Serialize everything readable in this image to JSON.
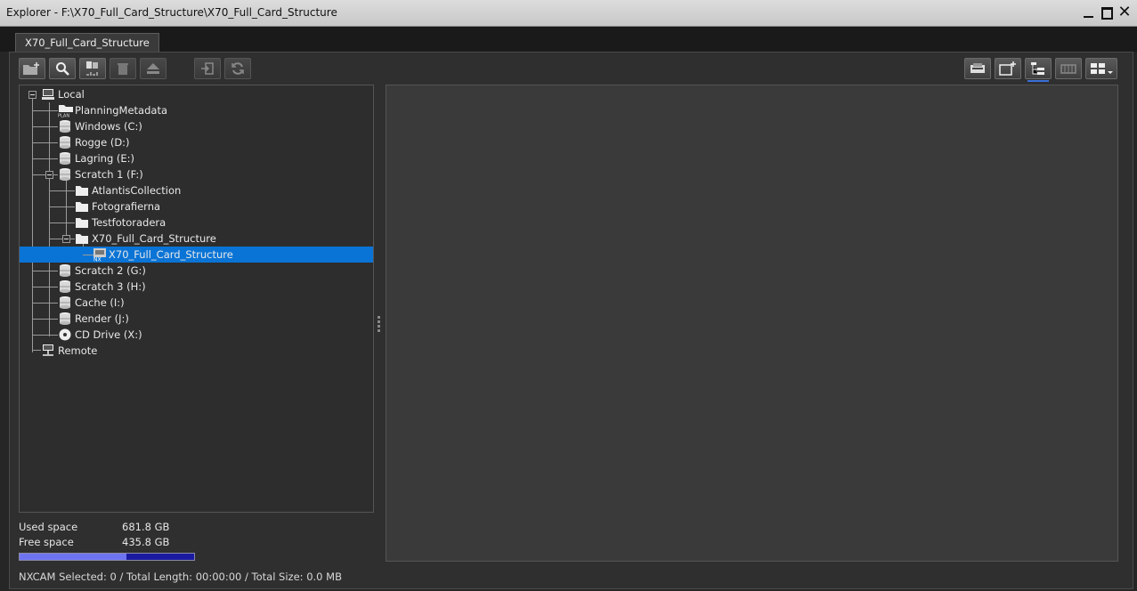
{
  "window": {
    "title": "Explorer - F:\\X70_Full_Card_Structure\\X70_Full_Card_Structure"
  },
  "tab": {
    "label": "X70_Full_Card_Structure"
  },
  "toolbar_left": [
    {
      "name": "new-folder-button",
      "icon": "new-folder-icon",
      "enabled": true
    },
    {
      "name": "search-button",
      "icon": "search-icon",
      "enabled": true
    },
    {
      "name": "select-all-button",
      "icon": "select-all-icon",
      "enabled": true
    },
    {
      "name": "delete-button",
      "icon": "trash-icon",
      "enabled": false
    },
    {
      "name": "eject-button",
      "icon": "eject-icon",
      "enabled": false
    },
    {
      "name": "import-button",
      "icon": "import-icon",
      "enabled": false
    },
    {
      "name": "refresh-button",
      "icon": "refresh-icon",
      "enabled": false
    }
  ],
  "toolbar_right": [
    {
      "name": "card-view-button",
      "icon": "card-reader-icon",
      "active": false
    },
    {
      "name": "new-window-button",
      "icon": "new-window-icon",
      "active": false
    },
    {
      "name": "tree-view-button",
      "icon": "tree-view-icon",
      "active": true
    },
    {
      "name": "list-view-button",
      "icon": "list-view-icon",
      "active": false
    },
    {
      "name": "thumbnail-view-button",
      "icon": "thumbnail-view-icon",
      "active": false
    }
  ],
  "tree": [
    {
      "label": "Local",
      "icon": "computer-icon",
      "level": 0,
      "expanded": true
    },
    {
      "label": "PlanningMetadata",
      "icon": "plan-folder-icon",
      "level": 1
    },
    {
      "label": "Windows (C:)",
      "icon": "drive-icon",
      "level": 1
    },
    {
      "label": "Rogge (D:)",
      "icon": "drive-icon",
      "level": 1
    },
    {
      "label": "Lagring (E:)",
      "icon": "drive-icon",
      "level": 1
    },
    {
      "label": "Scratch 1 (F:)",
      "icon": "drive-icon",
      "level": 1,
      "expanded": true
    },
    {
      "label": "AtlantisCollection",
      "icon": "folder-icon",
      "level": 2
    },
    {
      "label": "Fotografierna",
      "icon": "folder-icon",
      "level": 2
    },
    {
      "label": "Testfotoradera",
      "icon": "folder-icon",
      "level": 2
    },
    {
      "label": "X70_Full_Card_Structure",
      "icon": "folder-icon",
      "level": 2,
      "expanded": true
    },
    {
      "label": "X70_Full_Card_Structure",
      "icon": "nxcam-card-icon",
      "level": 3,
      "selected": true
    },
    {
      "label": "Scratch 2 (G:)",
      "icon": "drive-icon",
      "level": 1
    },
    {
      "label": "Scratch 3 (H:)",
      "icon": "drive-icon",
      "level": 1
    },
    {
      "label": "Cache (I:)",
      "icon": "drive-icon",
      "level": 1
    },
    {
      "label": "Render (J:)",
      "icon": "drive-icon",
      "level": 1
    },
    {
      "label": "CD Drive (X:)",
      "icon": "cd-drive-icon",
      "level": 1
    },
    {
      "label": "Remote",
      "icon": "network-icon",
      "level": 0
    }
  ],
  "space": {
    "used_label": "Used space",
    "used_value": "681.8 GB",
    "free_label": "Free space",
    "free_value": "435.8 GB",
    "used_fraction": 0.61
  },
  "status": "NXCAM  Selected: 0 / Total Length: 00:00:00 / Total Size: 0.0 MB",
  "colors": {
    "selection": "#0a74d6",
    "usage_fill": "#6e74f0",
    "usage_track": "#1a1aa0"
  }
}
